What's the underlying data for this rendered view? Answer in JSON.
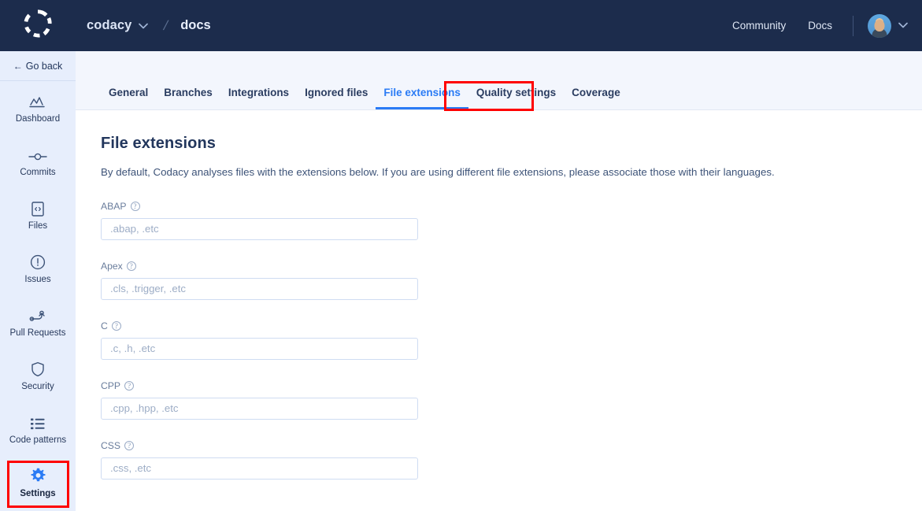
{
  "topnav": {
    "logo_icon": "codacy-logo-icon",
    "org": "codacy",
    "org_chevron_icon": "chevron-down-icon",
    "separator": "/",
    "repo": "docs",
    "links": [
      {
        "label": "Community",
        "name": "community-link"
      },
      {
        "label": "Docs",
        "name": "docs-link"
      }
    ],
    "avatar_alt": "user-avatar",
    "avatar_chevron_icon": "chevron-down-icon"
  },
  "sidebar": {
    "go_back": {
      "arrow": "←",
      "label": "Go back"
    },
    "items": [
      {
        "label": "Dashboard",
        "icon": "chart-line-icon",
        "name": "sidebar-item-dashboard",
        "active": false
      },
      {
        "label": "Commits",
        "icon": "commit-node-icon",
        "name": "sidebar-item-commits",
        "active": false
      },
      {
        "label": "Files",
        "icon": "file-code-icon",
        "name": "sidebar-item-files",
        "active": false
      },
      {
        "label": "Issues",
        "icon": "alert-circle-icon",
        "name": "sidebar-item-issues",
        "active": false
      },
      {
        "label": "Pull Requests",
        "icon": "pull-request-icon",
        "name": "sidebar-item-pull-requests",
        "active": false
      },
      {
        "label": "Security",
        "icon": "shield-icon",
        "name": "sidebar-item-security",
        "active": false
      },
      {
        "label": "Code patterns",
        "icon": "list-icon",
        "name": "sidebar-item-code-patterns",
        "active": false
      },
      {
        "label": "Settings",
        "icon": "gear-icon",
        "name": "sidebar-item-settings",
        "active": true
      }
    ]
  },
  "tabs": [
    {
      "label": "General",
      "name": "tab-general",
      "active": false
    },
    {
      "label": "Branches",
      "name": "tab-branches",
      "active": false
    },
    {
      "label": "Integrations",
      "name": "tab-integrations",
      "active": false
    },
    {
      "label": "Ignored files",
      "name": "tab-ignored-files",
      "active": false
    },
    {
      "label": "File extensions",
      "name": "tab-file-extensions",
      "active": true
    },
    {
      "label": "Quality settings",
      "name": "tab-quality-settings",
      "active": false
    },
    {
      "label": "Coverage",
      "name": "tab-coverage",
      "active": false
    }
  ],
  "main": {
    "title": "File extensions",
    "description": "By default, Codacy analyses files with the extensions below. If you are using different file extensions, please associate those with their languages.",
    "help_glyph": "?",
    "fields": [
      {
        "label": "ABAP",
        "placeholder": ".abap, .etc",
        "value": "",
        "name": "extensions-input-abap"
      },
      {
        "label": "Apex",
        "placeholder": ".cls, .trigger, .etc",
        "value": "",
        "name": "extensions-input-apex"
      },
      {
        "label": "C",
        "placeholder": ".c, .h, .etc",
        "value": "",
        "name": "extensions-input-c"
      },
      {
        "label": "CPP",
        "placeholder": ".cpp, .hpp, .etc",
        "value": "",
        "name": "extensions-input-cpp"
      },
      {
        "label": "CSS",
        "placeholder": ".css, .etc",
        "value": "",
        "name": "extensions-input-css"
      }
    ]
  },
  "annotations": {
    "highlight_color": "#ff0000",
    "settings_highlight": "sidebar-item-settings",
    "tab_highlight": "tab-file-extensions"
  },
  "colors": {
    "topnav_bg": "#1c2c4c",
    "sidebar_bg": "#e7eefc",
    "tabstrip_bg": "#f3f6fd",
    "accent_blue": "#2a7bf5",
    "text_dark": "#22365c"
  }
}
